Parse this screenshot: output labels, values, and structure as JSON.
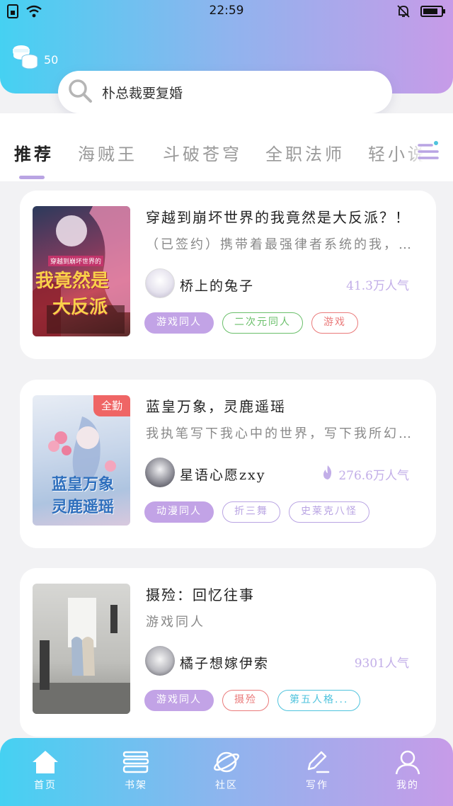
{
  "status_bar": {
    "time": "22:59"
  },
  "header": {
    "coin_count": "50"
  },
  "search": {
    "value": "朴总裁要复婚"
  },
  "tabs": [
    {
      "label": "推荐",
      "active": true
    },
    {
      "label": "海贼王",
      "active": false
    },
    {
      "label": "斗破苍穹",
      "active": false
    },
    {
      "label": "全职法师",
      "active": false
    },
    {
      "label": "轻小说",
      "active": false
    }
  ],
  "books": [
    {
      "title": "穿越到崩坏世界的我竟然是大反派？！",
      "description": "（已签约）携带着最强律者系统的我，...",
      "author": "桥上的兔子",
      "popularity": "41.3万人气",
      "badge": "",
      "cover_text": [
        "穿越到崩坏世界的",
        "我竟然是",
        "大反派"
      ],
      "tags": [
        {
          "label": "游戏同人",
          "style": "filled",
          "color": "#c2a3e6"
        },
        {
          "label": "二次元同人",
          "style": "outline",
          "color": "#6abf6a"
        },
        {
          "label": "游戏",
          "style": "outline",
          "color": "#ea7a7a"
        }
      ]
    },
    {
      "title": "蓝皇万象，灵鹿遥瑶",
      "description": "我执笔写下我心中的世界，写下我所幻...",
      "author": "星语心愿zxy",
      "popularity": "276.6万人气",
      "badge": "全勤",
      "cover_text": [
        "蓝皇万象",
        "灵鹿遥瑶"
      ],
      "tags": [
        {
          "label": "动漫同人",
          "style": "filled",
          "color": "#c2a3e6"
        },
        {
          "label": "折三舞",
          "style": "outline",
          "color": "#b9a4e3"
        },
        {
          "label": "史莱克八怪",
          "style": "outline",
          "color": "#b9a4e3"
        }
      ]
    },
    {
      "title": "摄殓：回忆往事",
      "description": "游戏同人",
      "author": "橘子想嫁伊索",
      "popularity": "9301人气",
      "badge": "",
      "cover_text": [],
      "tags": [
        {
          "label": "游戏同人",
          "style": "filled",
          "color": "#c2a3e6"
        },
        {
          "label": "摄殓",
          "style": "outline",
          "color": "#ea7a7a"
        },
        {
          "label": "第五人格...",
          "style": "outline",
          "color": "#4fc3dd"
        }
      ]
    }
  ],
  "bottom_nav": [
    {
      "label": "首页",
      "icon": "home-icon",
      "active": true
    },
    {
      "label": "书架",
      "icon": "bookshelf-icon",
      "active": false
    },
    {
      "label": "社区",
      "icon": "planet-icon",
      "active": false
    },
    {
      "label": "写作",
      "icon": "pen-icon",
      "active": false
    },
    {
      "label": "我的",
      "icon": "user-icon",
      "active": false
    }
  ],
  "colors": {
    "gradient_start": "#45d1f2",
    "gradient_end": "#c79be8",
    "accent_purple": "#c2a3e6",
    "popularity": "#c2aee8"
  }
}
